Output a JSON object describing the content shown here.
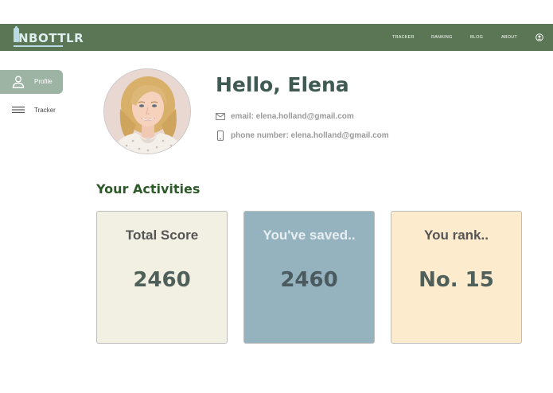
{
  "nav": {
    "logo_text": "NBOTTLR",
    "links": [
      "TRACKER",
      "RANKING",
      "BLOG",
      "ABOUT"
    ],
    "colors": {
      "bar": "#5a7654",
      "logo": "#b8dbe6"
    },
    "account_icon": "account-circle-icon"
  },
  "sidebar": {
    "items": [
      {
        "label": "Profile",
        "icon": "person-icon",
        "active": true
      },
      {
        "label": "Tracker",
        "icon": "menu-lines-icon",
        "active": false
      }
    ]
  },
  "profile": {
    "greeting": "Hello, Elena",
    "email": "email: elena.holland@gmail.com",
    "phone": "phone number: elena.holland@gmail.com",
    "email_icon": "mail-icon",
    "phone_icon": "phone-icon"
  },
  "activities": {
    "title": "Your Activities",
    "cards": [
      {
        "title": "Total Score",
        "value": "2460",
        "bg": "#f2efe3",
        "title_color": "#555555",
        "value_color": "#4f5f5a"
      },
      {
        "title": "You've saved..",
        "value": "2460",
        "bg": "#95b3bf",
        "title_color": "#e8edef",
        "value_color": "#4a5a5e"
      },
      {
        "title": "You rank..",
        "value": "No. 15",
        "bg": "#fdebcd",
        "title_color": "#555555",
        "value_color": "#4f5f5a"
      }
    ]
  }
}
